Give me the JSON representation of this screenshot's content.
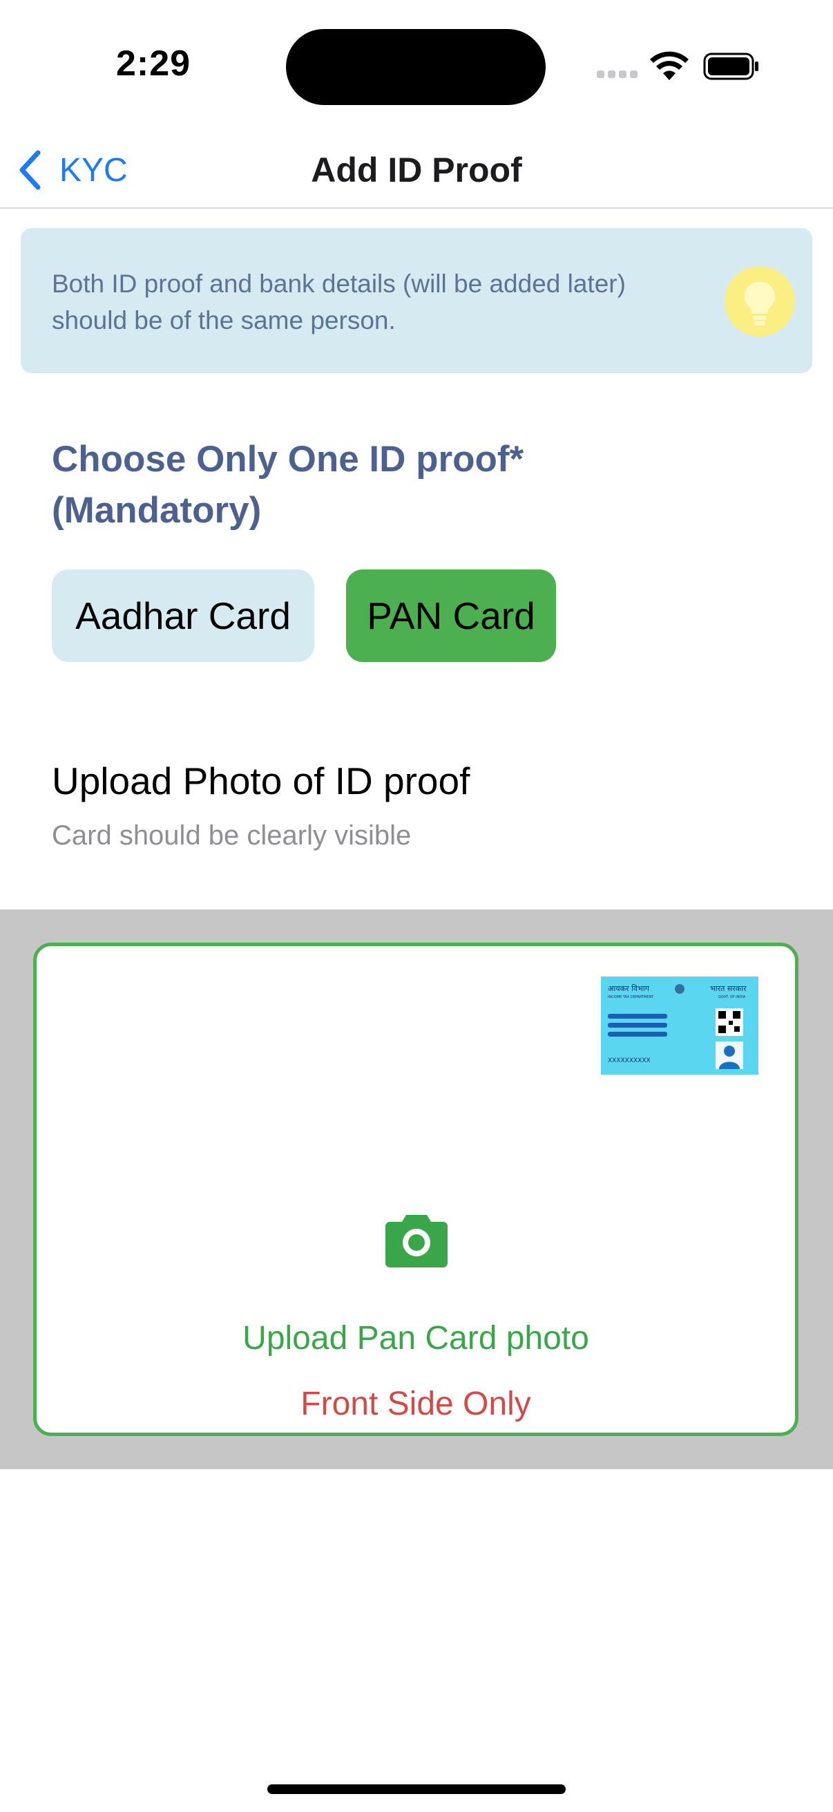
{
  "status_bar": {
    "time": "2:29"
  },
  "nav": {
    "back_label": "KYC",
    "title": "Add ID Proof"
  },
  "info_banner": {
    "text": "Both ID proof and bank details (will be added later) should be of the same person."
  },
  "id_section": {
    "title": "Choose Only One ID proof* (Mandatory)",
    "options": [
      {
        "label": "Aadhar Card",
        "selected": false
      },
      {
        "label": "PAN Card",
        "selected": true
      }
    ]
  },
  "upload_section": {
    "title": "Upload Photo of ID proof",
    "subtitle": "Card should be clearly visible",
    "card_label": "Upload Pan Card photo",
    "side_label": "Front Side Only",
    "pan_thumb": {
      "left_header": "आयकर विभाग",
      "left_sub": "INCOME TAX DEPARTMENT",
      "right_header": "भारत सरकार",
      "right_sub": "GOVT. OF INDIA",
      "number": "XXXXXXXXXX"
    }
  },
  "colors": {
    "accent_blue": "#1a7cf0",
    "selected_green": "#4caf50",
    "unselected_chip": "#d5eaf1",
    "warning_red": "#d04b45",
    "title_blue": "#4c6190"
  }
}
